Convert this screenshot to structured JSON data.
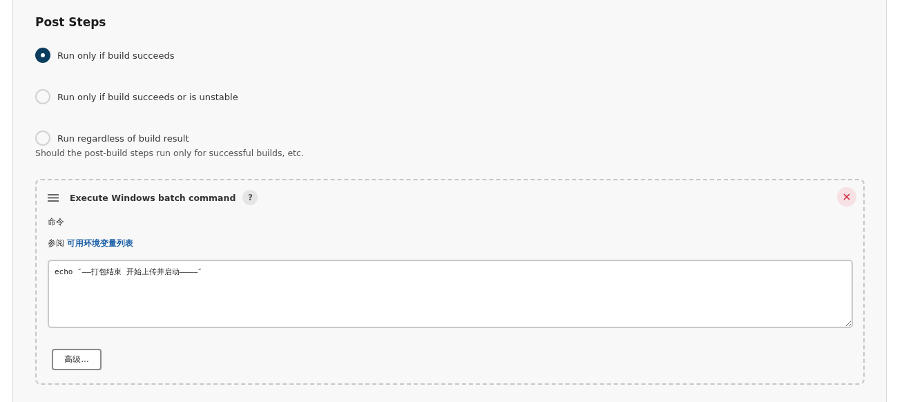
{
  "section_title": "Post Steps",
  "options": [
    {
      "label": "Run only if build succeeds",
      "selected": true
    },
    {
      "label": "Run only if build succeeds or is unstable",
      "selected": false
    },
    {
      "label": "Run regardless of build result",
      "selected": false
    }
  ],
  "options_help": "Should the post-build steps run only for successful builds, etc.",
  "step": {
    "title": "Execute Windows batch command",
    "help_icon": "?",
    "field_label": "命令",
    "see_also": "参阅",
    "env_link": "可用环境变量列表",
    "command": "echo ″——打包结束 开始上传并启动————″",
    "advanced_button": "高级..."
  }
}
